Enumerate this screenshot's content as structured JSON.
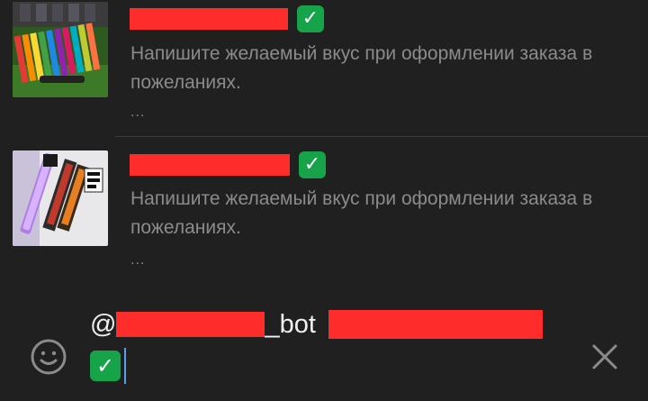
{
  "results": [
    {
      "thumbnail": "vape-bars-colorful-image",
      "title_visible": "",
      "verified_icon": "check-mark-icon",
      "description": "Напишите желаемый вкус при оформлении заказа в пожеланиях.",
      "more": "..."
    },
    {
      "thumbnail": "vape-device-boxes-image",
      "title_visible": "",
      "verified_icon": "check-mark-icon",
      "description": "Напишите желаемый вкус при оформлении заказа в пожеланиях.",
      "more": "..."
    }
  ],
  "composer": {
    "mention_prefix": "@",
    "bot_suffix": "_bot",
    "emoji_button_icon": "emoji-smile-icon",
    "close_button_icon": "close-x-icon",
    "check_glyph": "✓"
  },
  "colors": {
    "background": "#202020",
    "text_secondary": "#8b8b8b",
    "text_primary": "#f1f1f1",
    "redaction": "#ff2c2c",
    "check_green": "#16a34a"
  }
}
